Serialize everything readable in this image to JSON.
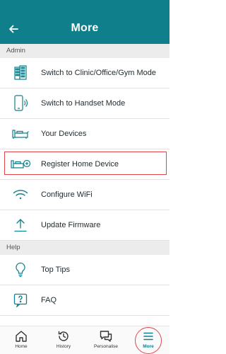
{
  "header": {
    "title": "More"
  },
  "sections": [
    {
      "title": "Admin",
      "items": [
        {
          "label": "Switch to Clinic/Office/Gym Mode",
          "icon": "building-icon"
        },
        {
          "label": "Switch to Handset Mode",
          "icon": "handset-icon"
        },
        {
          "label": "Your Devices",
          "icon": "device-icon"
        },
        {
          "label": "Register Home Device",
          "icon": "device-add-icon"
        },
        {
          "label": "Configure WiFi",
          "icon": "wifi-icon"
        },
        {
          "label": "Update Firmware",
          "icon": "upload-icon"
        }
      ]
    },
    {
      "title": "Help",
      "items": [
        {
          "label": "Top Tips",
          "icon": "lightbulb-icon"
        },
        {
          "label": "FAQ",
          "icon": "question-icon"
        }
      ]
    }
  ],
  "tabs": [
    {
      "label": "Home",
      "icon": "home-icon"
    },
    {
      "label": "History",
      "icon": "history-icon"
    },
    {
      "label": "Personalise",
      "icon": "chat-icon"
    },
    {
      "label": "More",
      "icon": "menu-icon"
    }
  ],
  "colors": {
    "primary": "#0f7f8c",
    "highlight": "#e0474c",
    "section_bg": "#ececec"
  }
}
